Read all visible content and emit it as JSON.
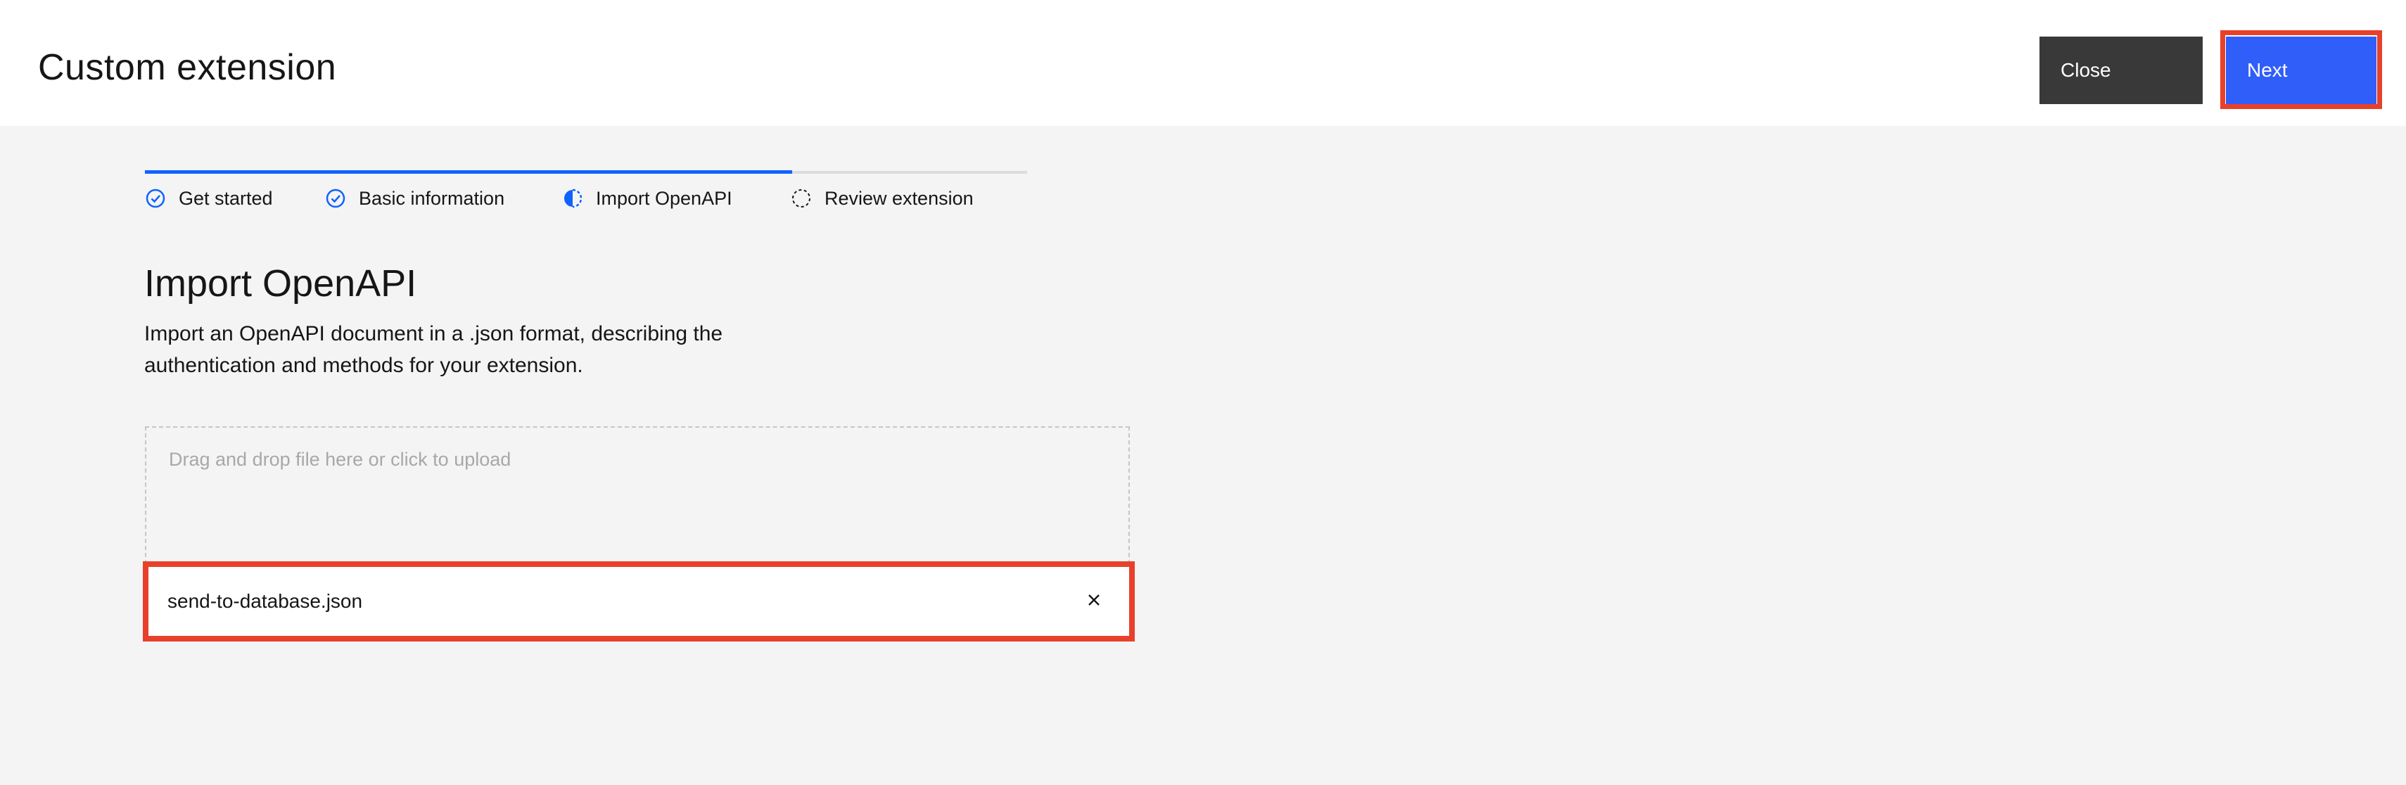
{
  "header": {
    "title": "Custom extension",
    "close_label": "Close",
    "next_label": "Next"
  },
  "progress": {
    "steps": [
      {
        "label": "Get started",
        "state": "complete",
        "icon": "checkmark-outline-icon"
      },
      {
        "label": "Basic information",
        "state": "complete",
        "icon": "checkmark-outline-icon"
      },
      {
        "label": "Import OpenAPI",
        "state": "current",
        "icon": "incomplete-half-icon"
      },
      {
        "label": "Review extension",
        "state": "incomplete",
        "icon": "circle-dash-icon"
      }
    ]
  },
  "main": {
    "title": "Import OpenAPI",
    "description": "Import an OpenAPI document in a .json format, describing the authentication and methods for your extension.",
    "dropzone_text": "Drag and drop file here or click to upload",
    "file": {
      "name": "send-to-database.json",
      "remove_icon": "close-icon"
    }
  },
  "colors": {
    "accent": "#0f62fe",
    "button_primary": "#2f5ef9",
    "button_secondary": "#393939",
    "highlight": "#e8402a",
    "background": "#f4f4f4"
  }
}
